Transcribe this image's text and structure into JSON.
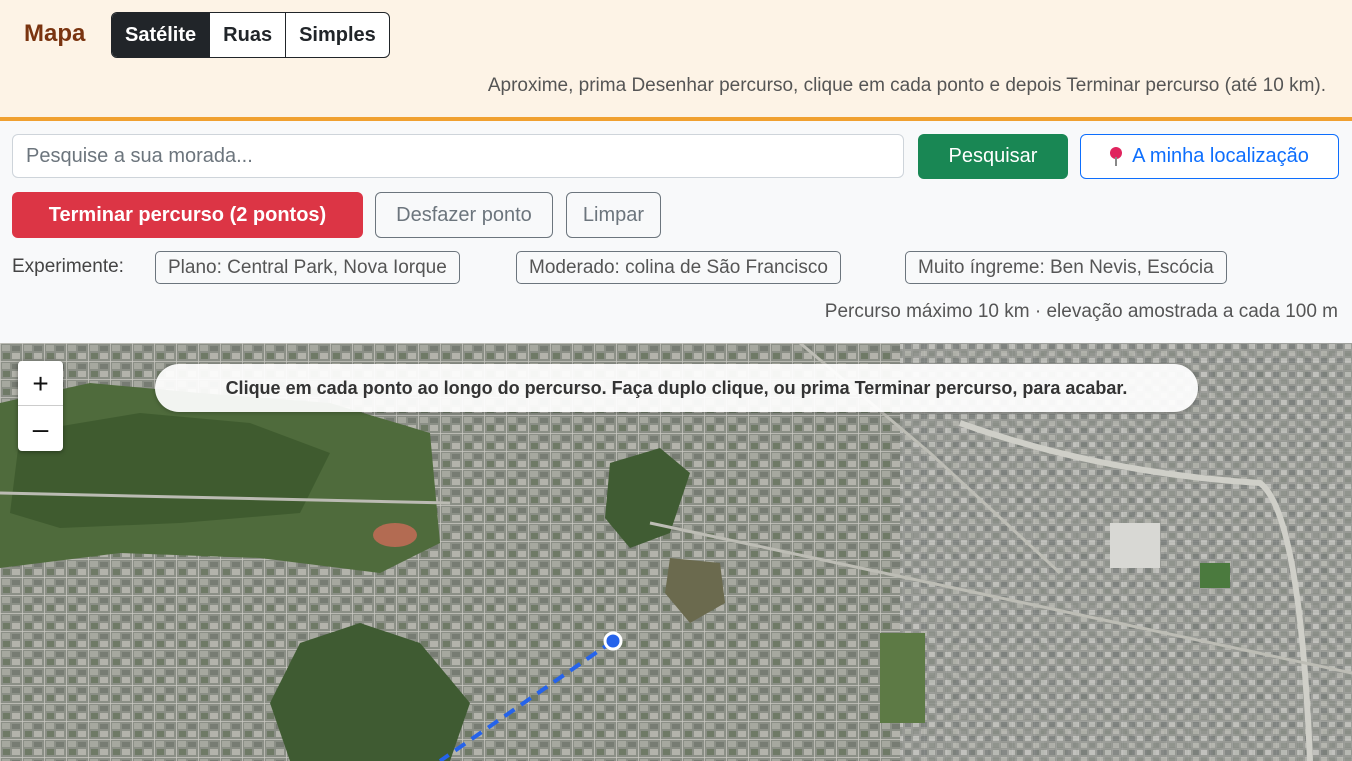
{
  "header": {
    "title": "Mapa",
    "layers": [
      "Satélite",
      "Ruas",
      "Simples"
    ],
    "active_layer": "Satélite",
    "hint": "Aproxime, prima Desenhar percurso, clique em cada ponto e depois Terminar percurso (até 10 km)."
  },
  "search": {
    "placeholder": "Pesquise a sua morada...",
    "value": "",
    "button_label": "Pesquisar",
    "location_label": "A minha localização",
    "location_icon": "pin-icon"
  },
  "actions": {
    "finish_label": "Terminar percurso (2 pontos)",
    "undo_label": "Desfazer ponto",
    "clear_label": "Limpar"
  },
  "examples": {
    "label": "Experimente:",
    "items": [
      "Plano: Central Park, Nova Iorque",
      "Moderado: colina de São Francisco",
      "Muito íngreme: Ben Nevis, Escócia"
    ]
  },
  "route_info": "Percurso máximo 10 km · elevação amostrada a cada 100 m",
  "map": {
    "zoom_in": "+",
    "zoom_out": "–",
    "instruction": "Clique em cada ponto ao longo do percurso. Faça duplo clique, ou prima Terminar percurso, para acabar.",
    "route_color": "#2563eb"
  },
  "colors": {
    "accent": "#f0a030",
    "title": "#7a3410",
    "search_button": "#198754",
    "finish_button": "#dc3545",
    "location_button": "#0d6efd"
  }
}
